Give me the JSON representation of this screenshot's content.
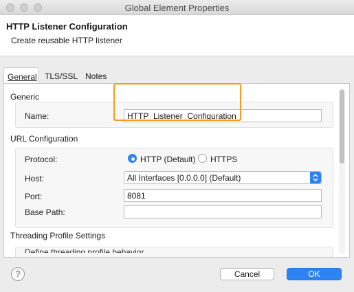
{
  "window": {
    "title": "Global Element Properties"
  },
  "header": {
    "title": "HTTP Listener Configuration",
    "subtitle": "Create reusable HTTP listener"
  },
  "tabs": [
    {
      "label": "General",
      "active": true
    },
    {
      "label": "TLS/SSL",
      "active": false
    },
    {
      "label": "Notes",
      "active": false
    }
  ],
  "generic": {
    "title": "Generic",
    "name_label": "Name:",
    "name_value": "HTTP_Listener_Configuration"
  },
  "url": {
    "title": "URL Configuration",
    "protocol_label": "Protocol:",
    "protocol_options": [
      {
        "label": "HTTP (Default)",
        "selected": true
      },
      {
        "label": "HTTPS",
        "selected": false
      }
    ],
    "host_label": "Host:",
    "host_value": "All Interfaces [0.0.0.0] (Default)",
    "port_label": "Port:",
    "port_value": "8081",
    "base_path_label": "Base Path:",
    "base_path_value": ""
  },
  "threading": {
    "title": "Threading Profile Settings",
    "desc": "Define threading profile behavior"
  },
  "footer": {
    "help_symbol": "?",
    "cancel_label": "Cancel",
    "ok_label": "OK"
  },
  "colors": {
    "accent": "#2e83f3",
    "highlight": "#f59a23"
  }
}
